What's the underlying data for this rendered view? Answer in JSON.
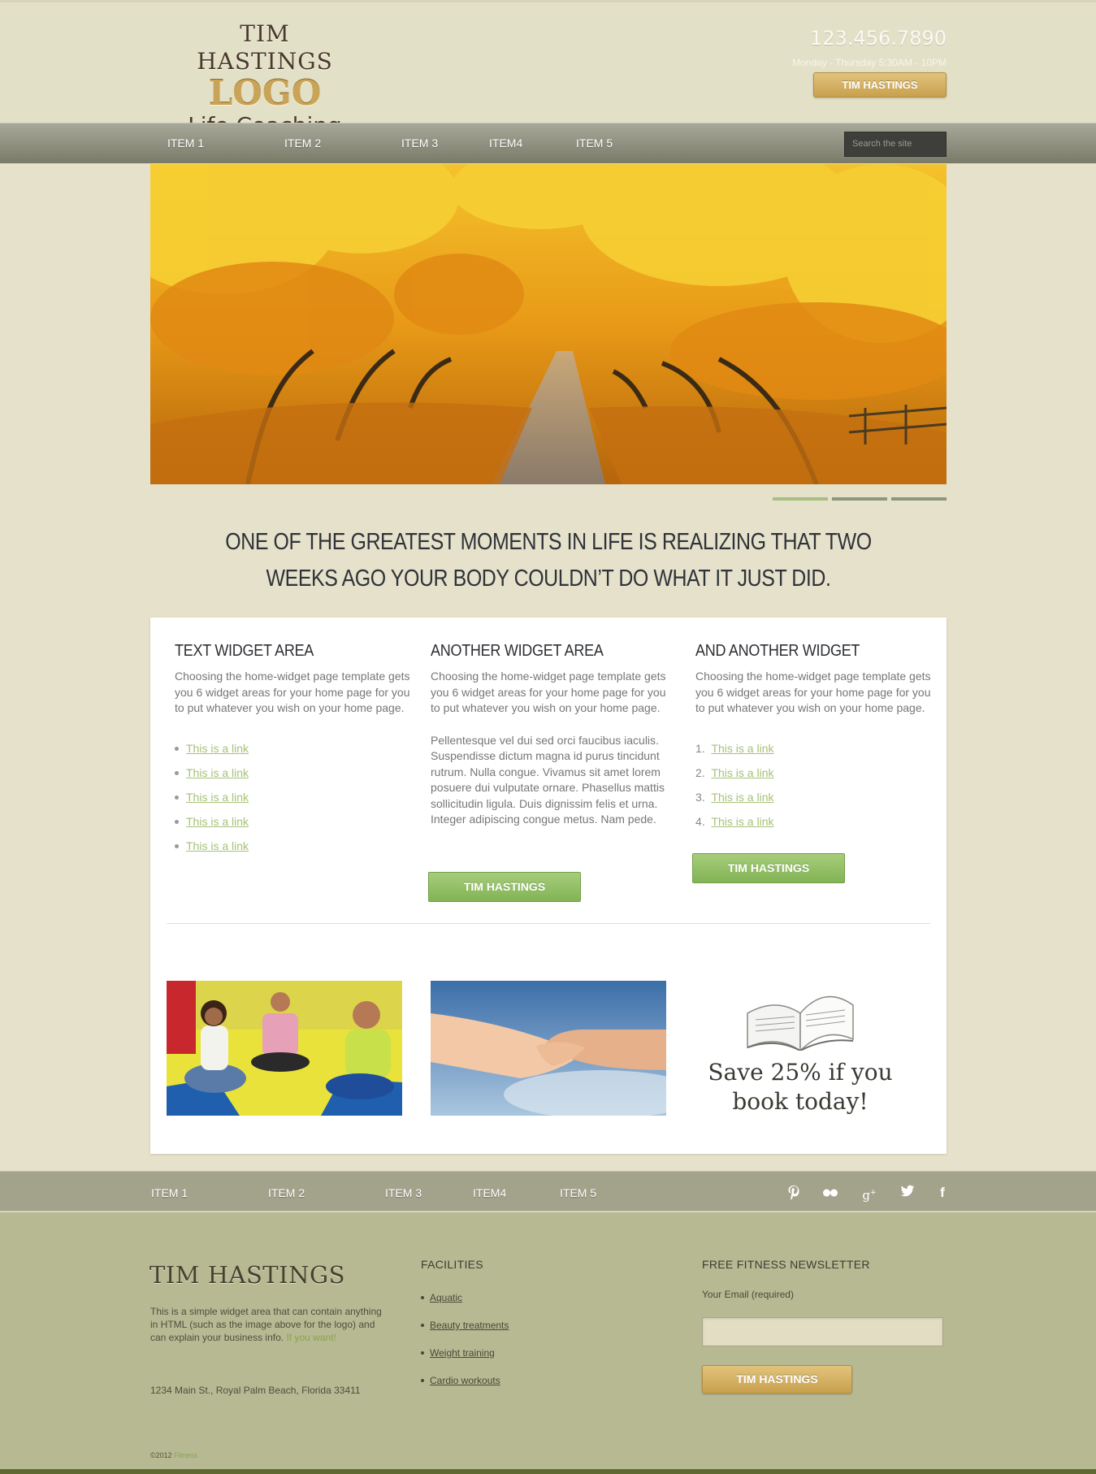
{
  "header": {
    "logo_line1": "TIM HASTINGS",
    "logo_line2": "LOGO",
    "logo_line3": "Life Coaching",
    "phone": "123.456.7890",
    "hours": "Monday - Thursday 5:30AM - 10PM",
    "cta_label": "TIM HASTINGS"
  },
  "nav": {
    "items": [
      "ITEM 1",
      "ITEM 2",
      "ITEM 3",
      "ITEM4",
      "ITEM 5"
    ],
    "search_placeholder": "Search the site"
  },
  "slider": {
    "slides": 3,
    "active": 1
  },
  "quote": "ONE OF THE GREATEST MOMENTS IN LIFE IS REALIZING THAT TWO WEEKS AGO YOUR BODY COULDN’T DO WHAT IT JUST DID.",
  "widgets": [
    {
      "title": "TEXT WIDGET AREA",
      "text": "Choosing the home-widget page template gets you 6 widget areas for your home page for you to put whatever you wish on your home page.",
      "links": [
        "This is a link",
        "This is a link",
        "This is a link",
        "This is a link",
        "This is a link"
      ]
    },
    {
      "title": "ANOTHER WIDGET AREA",
      "text": "Choosing the home-widget page template gets you 6 widget areas for your home page for you to put whatever you wish on your home page.",
      "text2": "Pellentesque vel dui sed orci faucibus iaculis. Suspendisse dictum magna id purus tincidunt rutrum. Nulla congue. Vivamus sit amet lorem posuere dui vulputate ornare. Phasellus mattis sollicitudin ligula. Duis dignissim felis et urna. Integer adipiscing congue metus. Nam pede.",
      "button": "TIM HASTINGS"
    },
    {
      "title": "AND ANOTHER WIDGET",
      "text": "Choosing the home-widget page template gets you 6 widget areas for your home page for you to put whatever you wish on your home page.",
      "links": [
        "This is a link",
        "This is a link",
        "This is a link",
        "This is a link"
      ],
      "numbers": [
        "1.",
        "2.",
        "3.",
        "4."
      ],
      "button": "TIM HASTINGS"
    }
  ],
  "promo": {
    "line1": "Save 25% if you",
    "line2": "book today!"
  },
  "footer_nav": {
    "items": [
      "ITEM 1",
      "ITEM 2",
      "ITEM 3",
      "ITEM4",
      "ITEM 5"
    ],
    "social_icons": [
      "pinterest-icon",
      "flickr-icon",
      "google-plus-icon",
      "twitter-icon",
      "facebook-icon"
    ]
  },
  "footer": {
    "logo": "TIM HASTINGS",
    "about_text": "This is a simple widget area that can contain anything in HTML (such as the image above for the logo) and can explain your business info.",
    "about_link": "If you want!",
    "address": "1234 Main St., Royal Palm Beach, Florida 33411",
    "copyright": "©2012",
    "copyright_link": "Fitness",
    "facilities_title": "FACILITIES",
    "facilities": [
      "Aquatic",
      "Beauty treatments",
      "Weight training",
      "Cardio workouts"
    ],
    "newsletter_title": "FREE FITNESS NEWSLETTER",
    "email_label": "Your Email (required)",
    "submit_label": "TIM HASTINGS"
  }
}
